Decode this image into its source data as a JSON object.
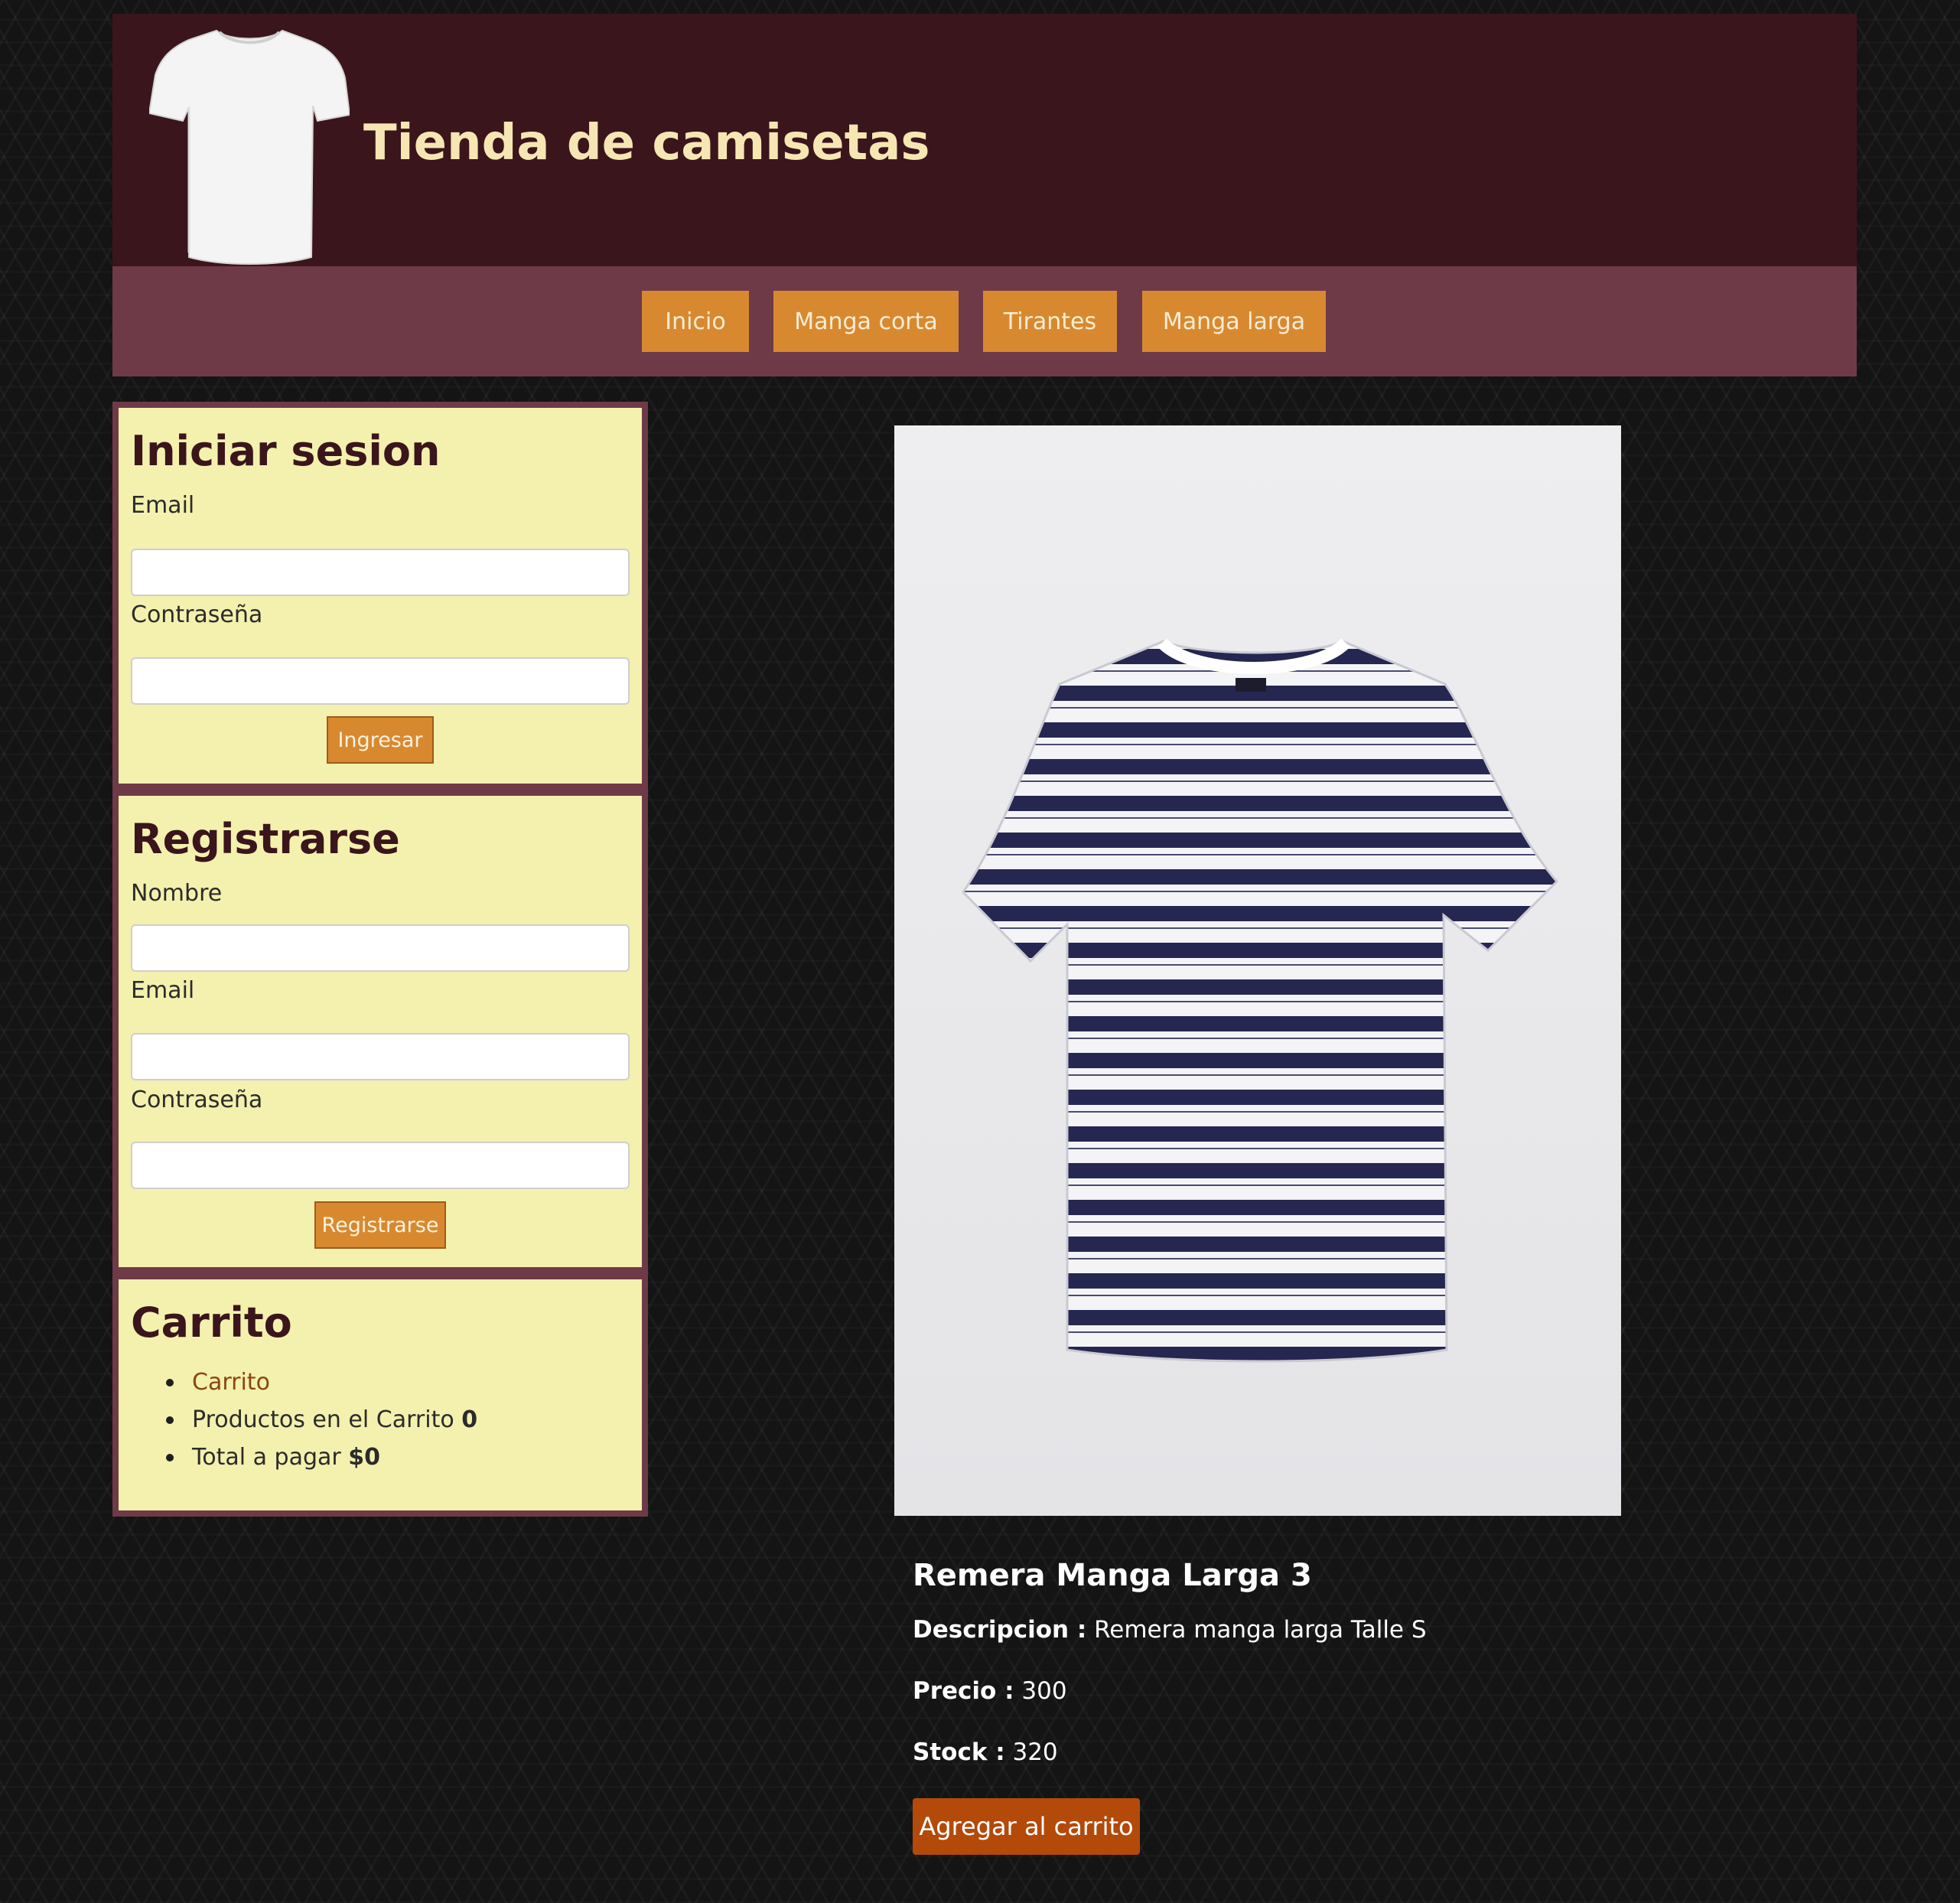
{
  "header": {
    "title": "Tienda de camisetas",
    "logo_icon": "white-tshirt-icon"
  },
  "nav": {
    "items": [
      {
        "label": "Inicio"
      },
      {
        "label": "Manga corta"
      },
      {
        "label": "Tirantes"
      },
      {
        "label": "Manga larga"
      }
    ]
  },
  "login": {
    "title": "Iniciar sesion",
    "email_label": "Email",
    "email_value": "",
    "password_label": "Contraseña",
    "password_value": "",
    "submit_label": "Ingresar"
  },
  "register": {
    "title": "Registrarse",
    "name_label": "Nombre",
    "name_value": "",
    "email_label": "Email",
    "email_value": "",
    "password_label": "Contraseña",
    "password_value": "",
    "submit_label": "Registrarse"
  },
  "cart": {
    "title": "Carrito",
    "link_label": "Carrito",
    "products_label": "Productos en el Carrito",
    "products_count": "0",
    "total_label": "Total a pagar",
    "total_value": "$0"
  },
  "product": {
    "image_icon": "striped-tshirt-image",
    "name": "Remera Manga Larga 3",
    "description_label": "Descripcion :",
    "description": "Remera manga larga Talle S",
    "price_label": "Precio :",
    "price": "300",
    "stock_label": "Stock :",
    "stock": "320",
    "add_to_cart_label": "Agregar al carrito"
  },
  "colors": {
    "header_bg": "#3a151c",
    "nav_bg": "#6e3a47",
    "button_orange": "#d88930",
    "panel_bg": "#f3f1ad",
    "add_button": "#b34a0a",
    "title_text": "#f6e6b3"
  }
}
